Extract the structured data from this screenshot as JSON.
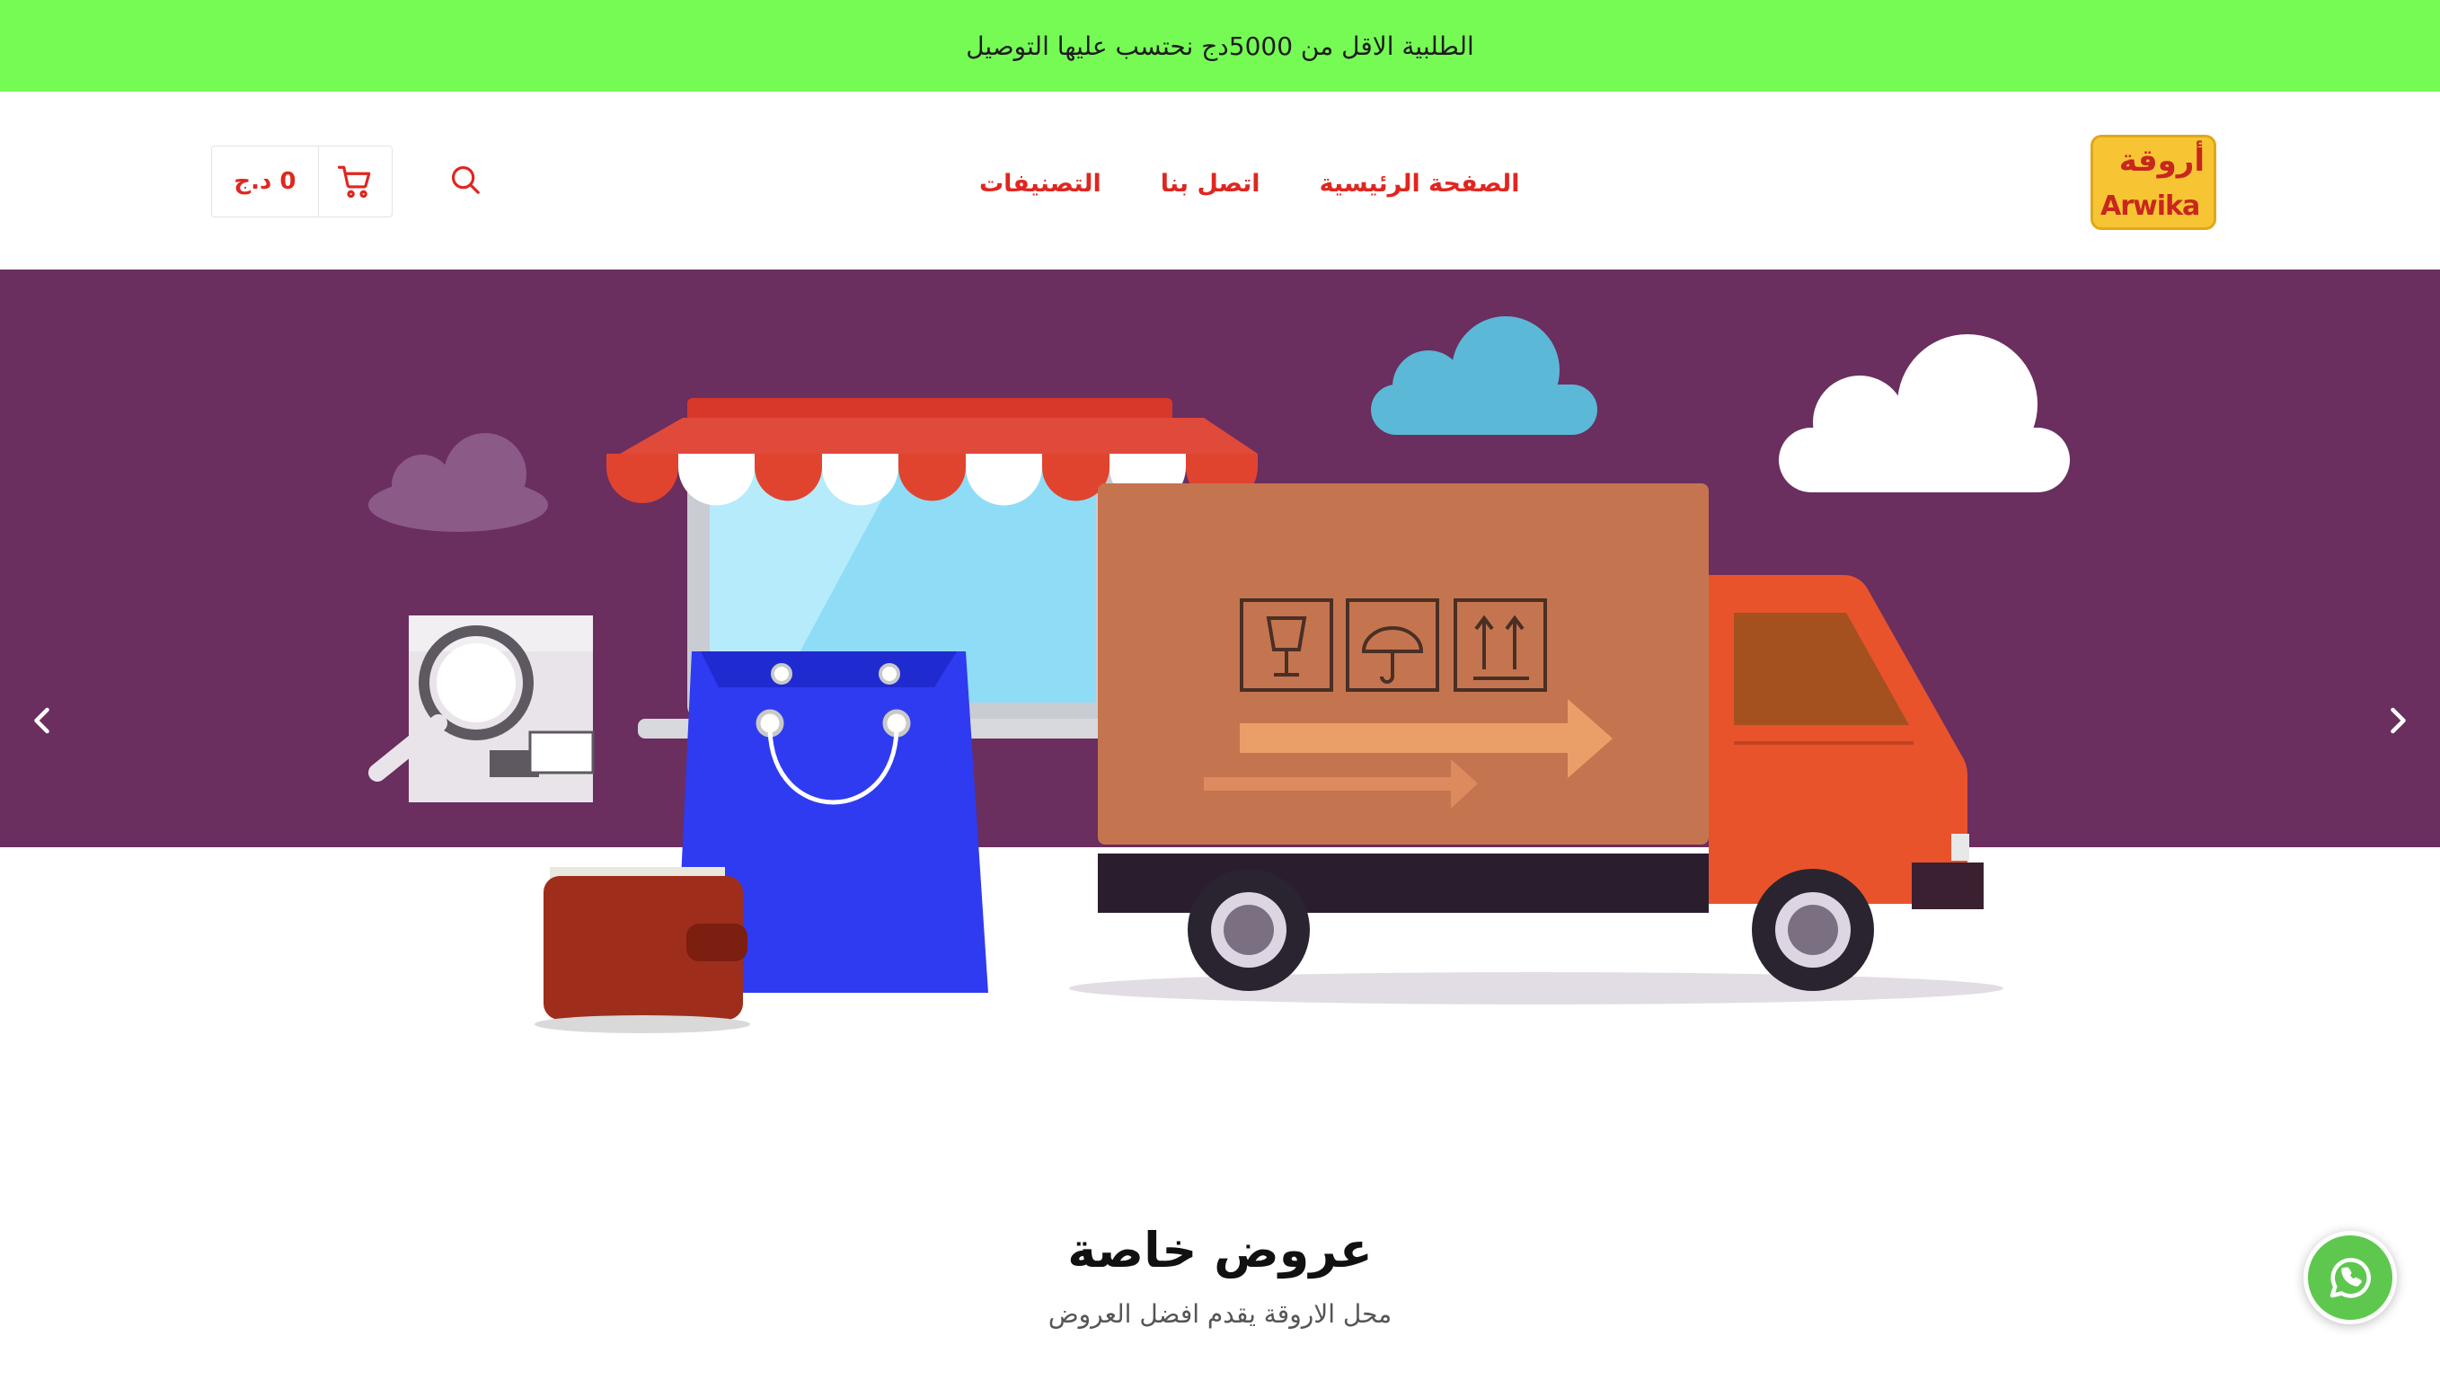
{
  "announcement": {
    "text": "الطلبية الاقل من 5000دج نحتسب عليها التوصيل"
  },
  "header": {
    "logo": {
      "arabic": "أروقة",
      "latin": "Arwika"
    },
    "nav": [
      {
        "label": "الصفحة الرئيسية"
      },
      {
        "label": "اتصل بنا"
      },
      {
        "label": "التصنيفات"
      }
    ],
    "search_icon": "search-icon",
    "cart": {
      "amount": "0 د.ج",
      "icon": "shopping-cart-icon"
    }
  },
  "slider": {
    "background_color": "#6a2e5f",
    "prev_icon": "chevron-left-icon",
    "next_icon": "chevron-right-icon",
    "slides_count": 2,
    "active_slide": 1
  },
  "section": {
    "title": "عروض خاصة",
    "subtitle": "محل الاروقة يقدم افضل العروض"
  },
  "floating": {
    "whatsapp_icon": "whatsapp-icon"
  },
  "colors": {
    "accent": "#e0261f",
    "announce_bg": "#76fb55",
    "brand_yellow": "#f7c533"
  }
}
